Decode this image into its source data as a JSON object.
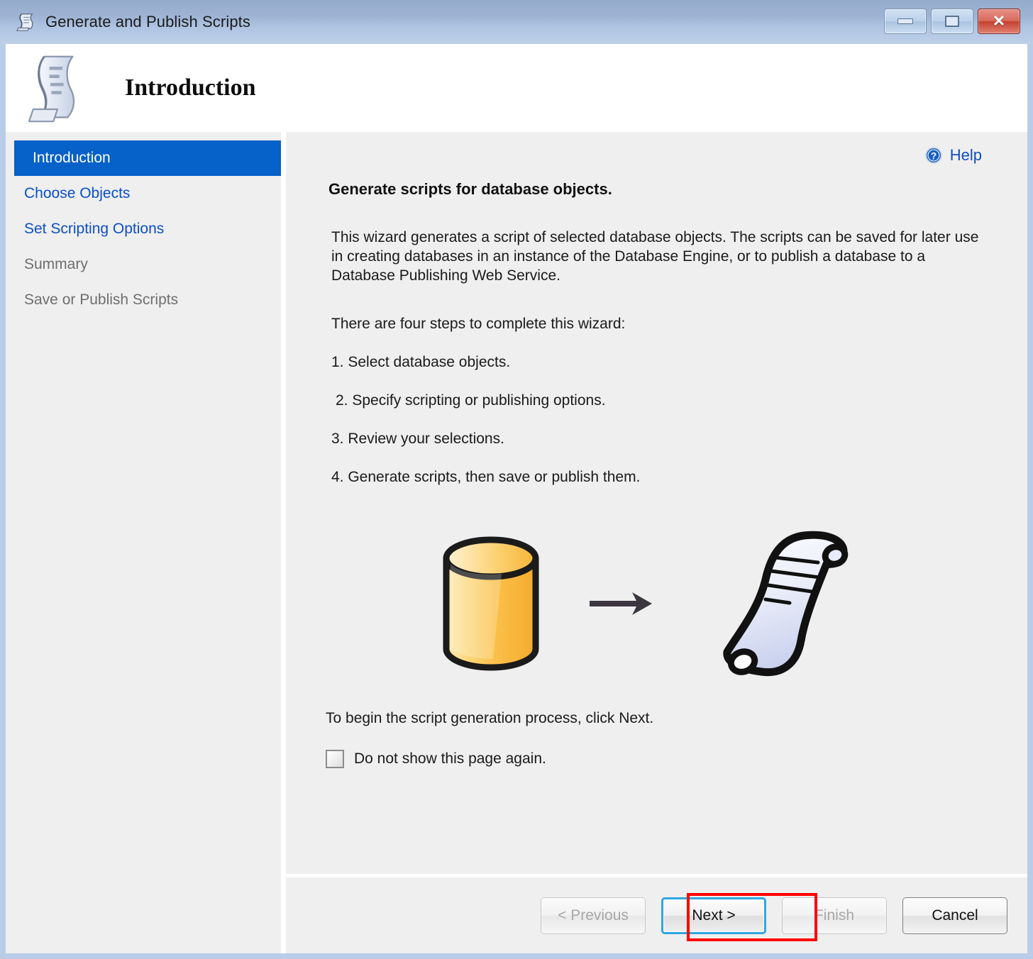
{
  "window": {
    "title": "Generate and Publish Scripts",
    "title_icon": "script-scroll-icon",
    "controls": [
      {
        "name": "minimize-button",
        "glyph": "minimize-icon",
        "label": ""
      },
      {
        "name": "maximize-button",
        "glyph": "maximize-icon",
        "label": ""
      },
      {
        "name": "close-button",
        "glyph": "close-icon",
        "label": "✕"
      }
    ]
  },
  "banner": {
    "icon": "script-scroll-icon",
    "title": "Introduction"
  },
  "sidebar": {
    "items": [
      {
        "label": "Introduction",
        "state": "active"
      },
      {
        "label": "Choose Objects",
        "state": "link"
      },
      {
        "label": "Set Scripting Options",
        "state": "link"
      },
      {
        "label": "Summary",
        "state": "disabled"
      },
      {
        "label": "Save or Publish Scripts",
        "state": "disabled"
      }
    ]
  },
  "help": {
    "label": "Help",
    "icon": "help-question-icon"
  },
  "main": {
    "heading": "Generate scripts for database objects.",
    "paragraph": "This wizard generates a script of selected database objects. The scripts can be saved for later use in creating databases in an instance of the Database Engine, or to publish a database to a Database Publishing Web Service.",
    "steps_intro": "There are four steps to complete this wizard:",
    "steps": [
      "1. Select database objects.",
      " 2. Specify scripting or publishing options.",
      "3. Review your selections.",
      "4. Generate scripts, then save or publish them."
    ],
    "illustration": {
      "source_icon": "database-cylinder-icon",
      "arrow_icon": "right-arrow-icon",
      "target_icon": "script-scroll-icon"
    },
    "footer_note": "To begin the script generation process, click Next.",
    "checkbox": {
      "label": "Do not show this page again.",
      "checked": false
    }
  },
  "buttons": [
    {
      "label": "< Previous",
      "name": "previous-button",
      "state": "disabled"
    },
    {
      "label": "Next >",
      "name": "next-button",
      "state": "focused"
    },
    {
      "label": "Finish",
      "name": "finish-button",
      "state": "disabled"
    },
    {
      "label": "Cancel",
      "name": "cancel-button",
      "state": "enabled"
    }
  ],
  "colors": {
    "accent_blue": "#0661c8",
    "link_blue": "#0b4fc4",
    "titlebar_top": "#94abcd",
    "titlebar_bottom": "#becfe8",
    "panel_gray": "#efefef",
    "focus_border": "#2fa5e0",
    "annotation_red": "#ff0000",
    "db_orange": "#fbb040"
  }
}
